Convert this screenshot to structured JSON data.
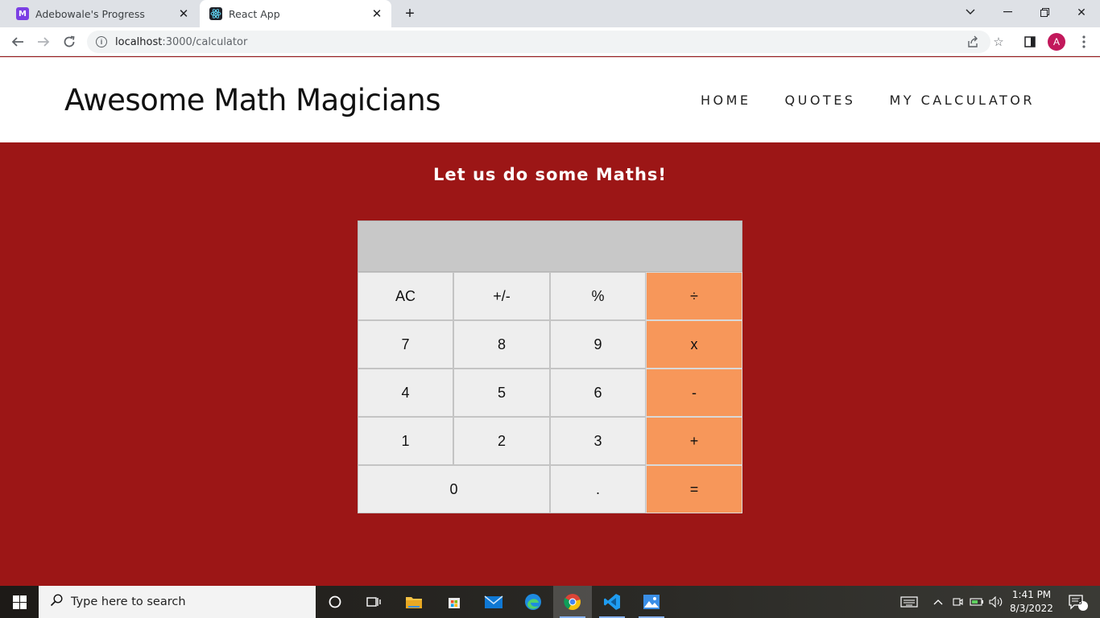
{
  "browser": {
    "tabs": [
      {
        "title": "Adebowale's Progress",
        "favicon": "notion-m-icon",
        "active": false
      },
      {
        "title": "React App",
        "favicon": "react-icon",
        "active": true
      }
    ],
    "url_host": "localhost",
    "url_rest": ":3000/calculator",
    "profile_initial": "A"
  },
  "header": {
    "brand": "Awesome Math Magicians",
    "nav": [
      {
        "label": "HOME"
      },
      {
        "label": "QUOTES"
      },
      {
        "label": "MY CALCULATOR"
      }
    ]
  },
  "main": {
    "heading": "Let us do some Maths!",
    "display": "",
    "keys": [
      {
        "label": "AC",
        "type": "fn"
      },
      {
        "label": "+/-",
        "type": "fn"
      },
      {
        "label": "%",
        "type": "fn"
      },
      {
        "label": "÷",
        "type": "op"
      },
      {
        "label": "7",
        "type": "num"
      },
      {
        "label": "8",
        "type": "num"
      },
      {
        "label": "9",
        "type": "num"
      },
      {
        "label": "x",
        "type": "op"
      },
      {
        "label": "4",
        "type": "num"
      },
      {
        "label": "5",
        "type": "num"
      },
      {
        "label": "6",
        "type": "num"
      },
      {
        "label": "-",
        "type": "op"
      },
      {
        "label": "1",
        "type": "num"
      },
      {
        "label": "2",
        "type": "num"
      },
      {
        "label": "3",
        "type": "num"
      },
      {
        "label": "+",
        "type": "op"
      },
      {
        "label": "0",
        "type": "num"
      },
      {
        "label": ".",
        "type": "num"
      },
      {
        "label": "=",
        "type": "op"
      }
    ]
  },
  "taskbar": {
    "search_placeholder": "Type here to search",
    "time": "1:41 PM",
    "date": "8/3/2022",
    "notification_count": "3"
  },
  "colors": {
    "page_background": "#9c1616",
    "operator_key": "#f7975a",
    "key": "#eeeeee",
    "display": "#c8c8c8"
  }
}
